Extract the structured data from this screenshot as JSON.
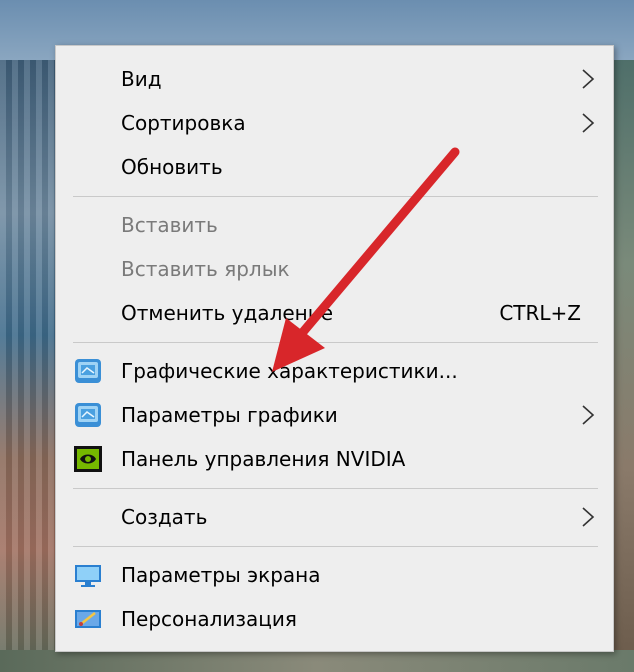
{
  "context_menu": {
    "items": [
      {
        "label": "Вид"
      },
      {
        "label": "Сортировка"
      },
      {
        "label": "Обновить"
      },
      {
        "label": "Вставить"
      },
      {
        "label": "Вставить ярлык"
      },
      {
        "label": "Отменить удаление",
        "shortcut": "CTRL+Z"
      },
      {
        "label": "Графические характеристики...",
        "icon": "intel-graphics-icon"
      },
      {
        "label": "Параметры графики",
        "icon": "intel-graphics-icon"
      },
      {
        "label": "Панель управления NVIDIA",
        "icon": "nvidia-icon"
      },
      {
        "label": "Создать"
      },
      {
        "label": "Параметры экрана",
        "icon": "display-icon"
      },
      {
        "label": "Персонализация",
        "icon": "personalize-icon"
      }
    ]
  },
  "colors": {
    "menu_background": "#eeeeee",
    "disabled_text": "#7a7a7a",
    "annotation_arrow": "#d8262a"
  }
}
